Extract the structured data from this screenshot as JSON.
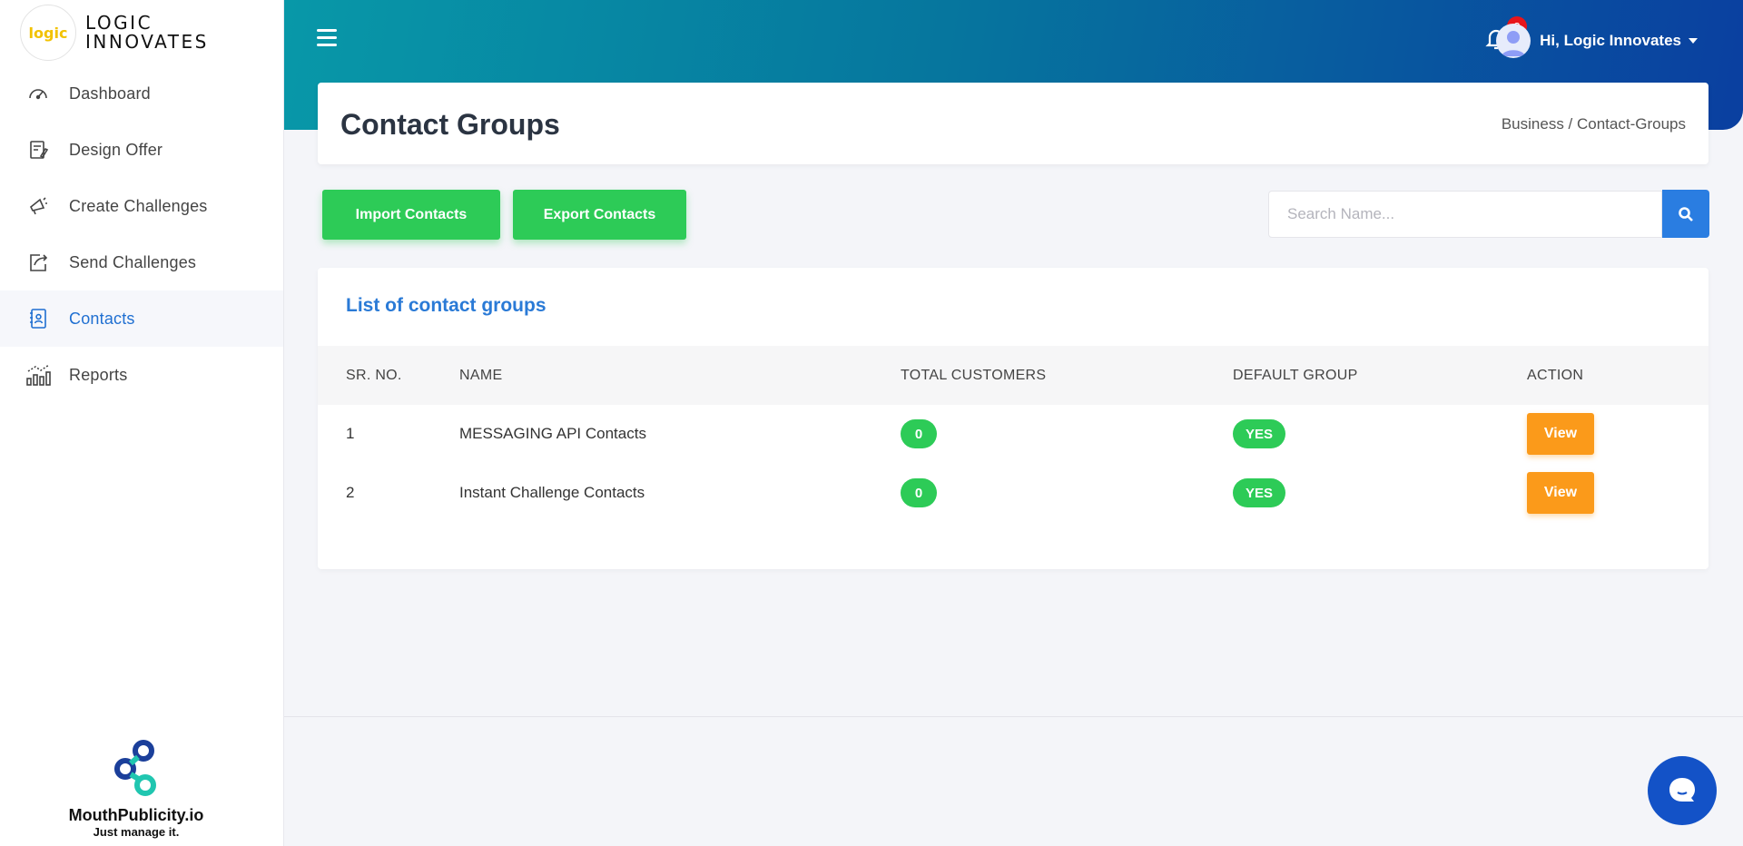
{
  "brand": {
    "logo_text": "logic",
    "name_line1": "LOGIC",
    "name_line2": "INNOVATES"
  },
  "sidebar": {
    "items": [
      {
        "label": "Dashboard",
        "icon": "speedometer-icon",
        "active": false
      },
      {
        "label": "Design Offer",
        "icon": "pencil-paper-icon",
        "active": false
      },
      {
        "label": "Create Challenges",
        "icon": "megaphone-icon",
        "active": false
      },
      {
        "label": "Send Challenges",
        "icon": "share-icon",
        "active": false
      },
      {
        "label": "Contacts",
        "icon": "contact-book-icon",
        "active": true
      },
      {
        "label": "Reports",
        "icon": "chart-icon",
        "active": false
      }
    ],
    "footer": {
      "title": "MouthPublicity.io",
      "tagline": "Just manage it."
    }
  },
  "header": {
    "notifications_count": "3",
    "greeting": "Hi, Logic Innovates"
  },
  "page": {
    "title": "Contact Groups",
    "breadcrumb": "Business / Contact-Groups"
  },
  "toolbar": {
    "import_label": "Import Contacts",
    "export_label": "Export Contacts",
    "search_placeholder": "Search Name..."
  },
  "table": {
    "title": "List of contact groups",
    "columns": [
      "SR. NO.",
      "NAME",
      "TOTAL CUSTOMERS",
      "DEFAULT GROUP",
      "ACTION"
    ],
    "rows": [
      {
        "sr": "1",
        "name": "MESSAGING API Contacts",
        "total": "0",
        "default": "YES",
        "action": "View"
      },
      {
        "sr": "2",
        "name": "Instant Challenge Contacts",
        "total": "0",
        "default": "YES",
        "action": "View"
      }
    ]
  },
  "colors": {
    "accent": "#2a7de1",
    "green": "#2dcb57",
    "orange": "#fb9a1a",
    "badge": "#e8151b"
  }
}
